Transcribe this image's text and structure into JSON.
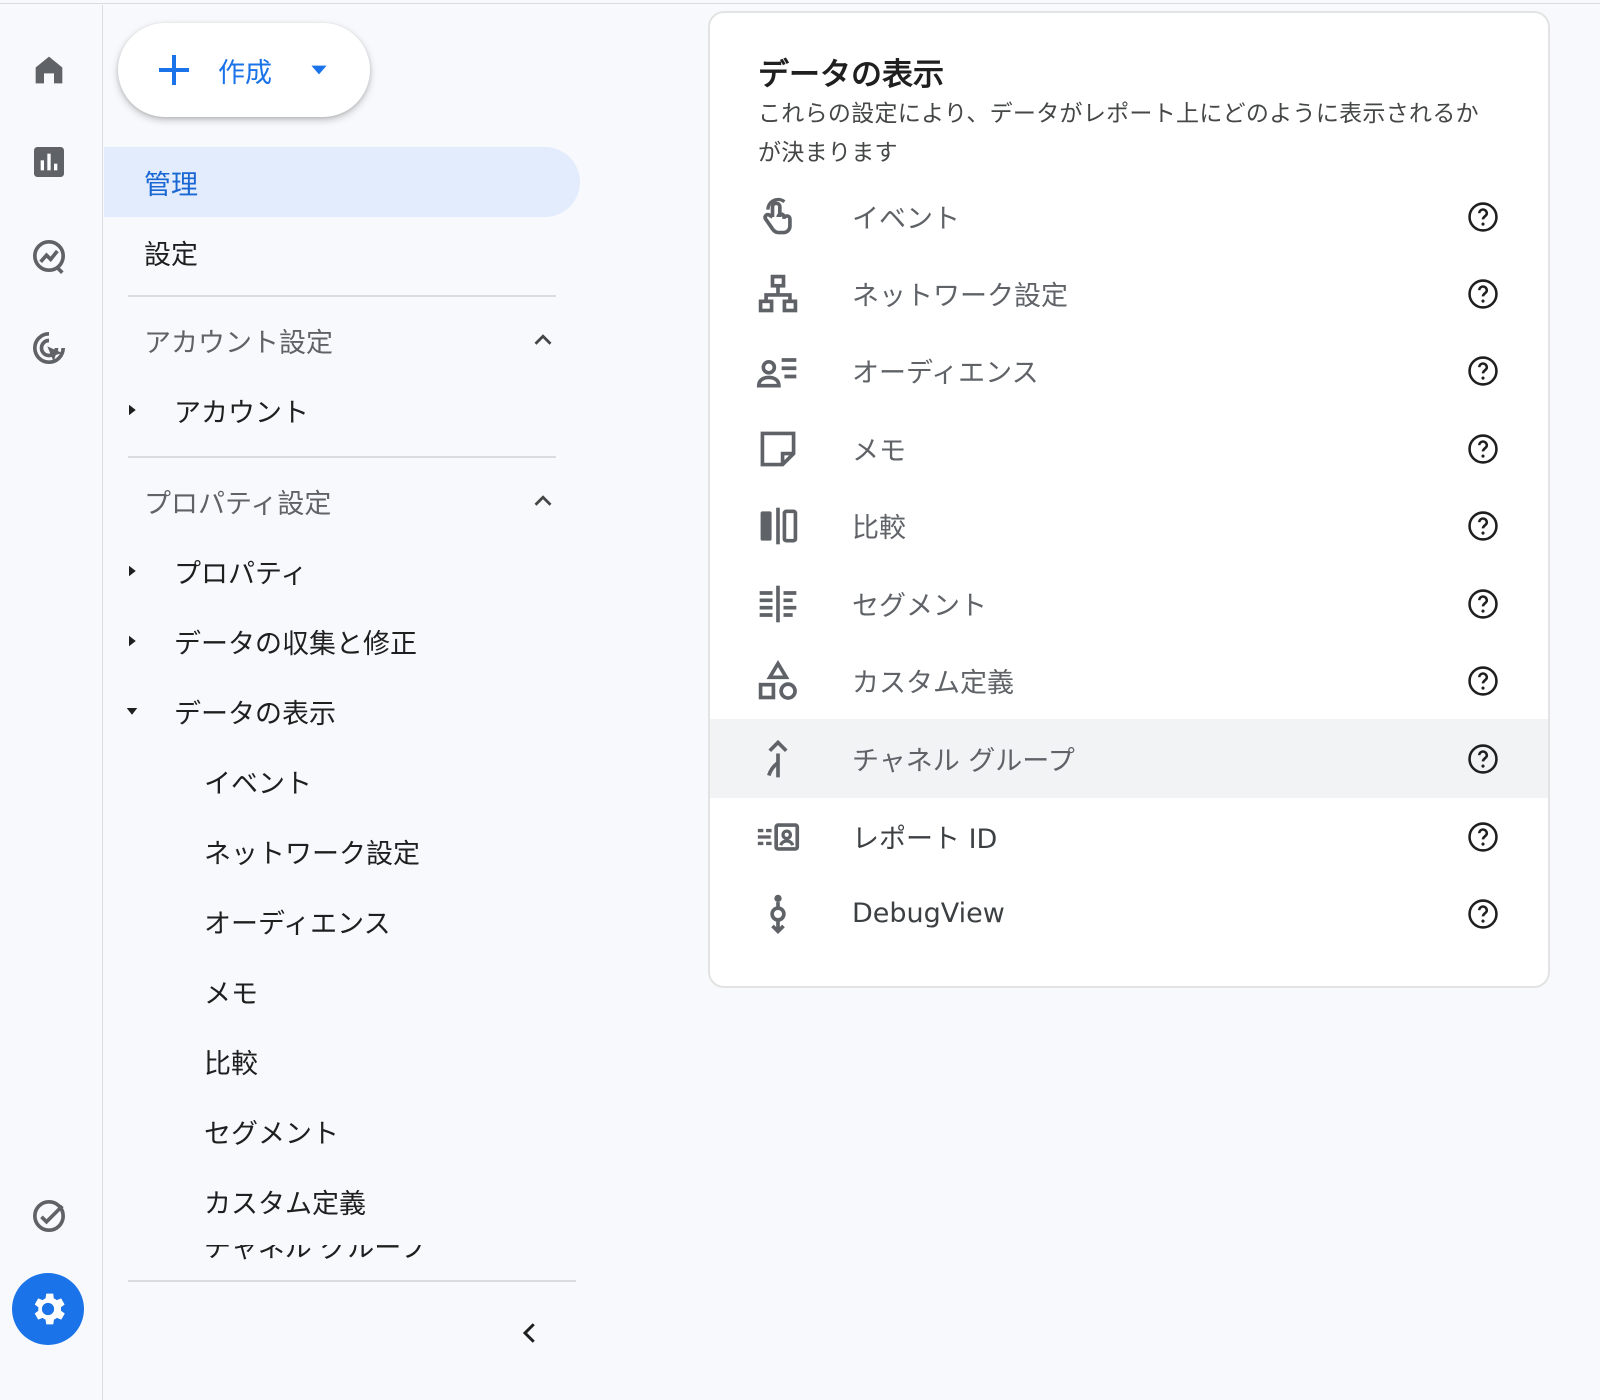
{
  "colors": {
    "accent": "#1a73e8",
    "active_bg": "#e3ecfc",
    "icon_gray": "#5f6368",
    "highlight_row": "#f1f3f4"
  },
  "rail": {
    "icons": [
      "home-icon",
      "reports-icon",
      "explore-icon",
      "advertising-icon",
      "check-icon",
      "admin-gear-icon"
    ]
  },
  "sidebar": {
    "create": {
      "label": "作成"
    },
    "admin_label": "管理",
    "settings_label": "設定",
    "account_section": {
      "title": "アカウント設定",
      "items": [
        {
          "label": "アカウント"
        }
      ]
    },
    "property_section": {
      "title": "プロパティ設定",
      "items": [
        {
          "label": "プロパティ"
        },
        {
          "label": "データの収集と修正"
        },
        {
          "label": "データの表示"
        }
      ],
      "sub_items": [
        {
          "label": "イベント"
        },
        {
          "label": "ネットワーク設定"
        },
        {
          "label": "オーディエンス"
        },
        {
          "label": "メモ"
        },
        {
          "label": "比較"
        },
        {
          "label": "セグメント"
        },
        {
          "label": "カスタム定義"
        },
        {
          "label": "チャネル グループ"
        }
      ]
    }
  },
  "main": {
    "title": "データの表示",
    "description": "これらの設定により、データがレポート上にどのように表示されるかが決まります",
    "rows": [
      {
        "label": "イベント",
        "icon": "touch-icon"
      },
      {
        "label": "ネットワーク設定",
        "icon": "network-icon"
      },
      {
        "label": "オーディエンス",
        "icon": "audience-icon"
      },
      {
        "label": "メモ",
        "icon": "note-icon"
      },
      {
        "label": "比較",
        "icon": "compare-icon"
      },
      {
        "label": "セグメント",
        "icon": "segment-icon"
      },
      {
        "label": "カスタム定義",
        "icon": "shapes-icon"
      },
      {
        "label": "チャネル グループ",
        "icon": "merge-icon"
      },
      {
        "label": "レポート ID",
        "icon": "report-id-icon"
      },
      {
        "label": "DebugView",
        "icon": "debug-icon"
      }
    ]
  }
}
